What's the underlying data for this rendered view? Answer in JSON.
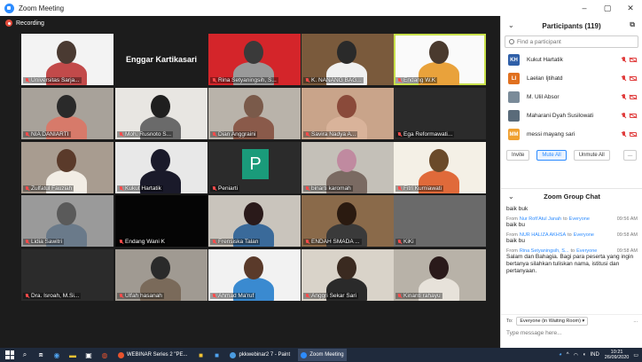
{
  "window": {
    "title": "Zoom Meeting",
    "minimize": "–",
    "maximize": "▢",
    "close": "✕"
  },
  "recording": {
    "label": "Recording",
    "color": "#e24b3b"
  },
  "tiles": [
    {
      "name": "Universitas Sarja...",
      "active": false
    },
    {
      "name": "Enggar Kartikasari",
      "active": false,
      "name_only": true
    },
    {
      "name": "Rina Setyaningsih, S...",
      "active": false
    },
    {
      "name": "K. NANANG BAG...",
      "active": false
    },
    {
      "name": "Endang W.K",
      "active": true
    },
    {
      "name": "NIA DANIARTI",
      "active": false
    },
    {
      "name": "Moh. Rusnoto S...",
      "active": false
    },
    {
      "name": "Dian Anggraini",
      "active": false
    },
    {
      "name": "Savira Nadya A...",
      "active": false
    },
    {
      "name": "Ega Reformawati...",
      "active": false
    },
    {
      "name": "Zulfatul Fauziah",
      "active": false
    },
    {
      "name": "Kukut Hartatik",
      "active": false
    },
    {
      "name": "Peniarti",
      "active": false,
      "letter": "P"
    },
    {
      "name": "binarti karomah",
      "active": false
    },
    {
      "name": "Fitri Kurniawati",
      "active": false
    },
    {
      "name": "Lidia Sawitri",
      "active": false
    },
    {
      "name": "Endang Wani K",
      "active": false
    },
    {
      "name": "Frensiska Talan",
      "active": false
    },
    {
      "name": "ENDAH SMADA ...",
      "active": false
    },
    {
      "name": "KiKi",
      "active": false
    },
    {
      "name": "Dra. Isroah, M.Si...",
      "active": false
    },
    {
      "name": "Ulfah hasanah",
      "active": false
    },
    {
      "name": "Ahmad Ma'ruf",
      "active": false
    },
    {
      "name": "Anggri Sekar Sari",
      "active": false
    },
    {
      "name": "Kinanti rahayu",
      "active": false
    }
  ],
  "participants": {
    "title": "Participants (119)",
    "search_placeholder": "Find a participant",
    "items": [
      {
        "initials": "KH",
        "name": "Kukut Hartatik",
        "color": "#2f5fa8"
      },
      {
        "initials": "LI",
        "name": "Laelan Ijtihatd",
        "color": "#e0701f"
      },
      {
        "initials": "",
        "name": "M. Ulil Absor",
        "color": "#7a8b99"
      },
      {
        "initials": "",
        "name": "Maharani Dyah Susilowati",
        "color": "#5a6b7a"
      },
      {
        "initials": "MM",
        "name": "messi mayang sari",
        "color": "#f0a030"
      }
    ],
    "buttons": {
      "invite": "Invite",
      "mute_all": "Mute All",
      "unmute_all": "Unmute All",
      "more": "..."
    }
  },
  "chat": {
    "title": "Zoom Group Chat",
    "messages": [
      {
        "from": "",
        "to": "",
        "time": "",
        "text": "baik buk"
      },
      {
        "from": "Nur Rofi'Atul Janah",
        "to": "Everyone",
        "time": "09:56 AM",
        "text": "baik bu"
      },
      {
        "from": "NUR HALIZA AKHSA",
        "to": "Everyone",
        "time": "09:58 AM",
        "text": "baik bu"
      },
      {
        "from": "Rina Setyaningsih, S...",
        "to": "Everyone",
        "time": "09:58 AM",
        "text": "Salam dan Bahagia. Bagi para peserta yang ingin bertanya silahkan tuliskan nama, istitusi dan pertanyaan."
      }
    ],
    "from_word": "From",
    "to_word": "to",
    "to_label": "To:",
    "recipient": "Everyone (in Waiting Room) ▾",
    "more": "...",
    "input_placeholder": "Type message here..."
  },
  "taskbar": {
    "apps": [
      {
        "label": "WEBINAR Series 2 \"PE...",
        "color": "#e8532d",
        "on": false
      },
      {
        "label": "pkkwebinar2 7 - Paint",
        "color": "#4a9be0",
        "on": false
      },
      {
        "label": "Zoom Meeting",
        "color": "#2d8cff",
        "on": true
      }
    ],
    "lang": "IND",
    "time": "10:21",
    "date": "26/09/2020"
  }
}
